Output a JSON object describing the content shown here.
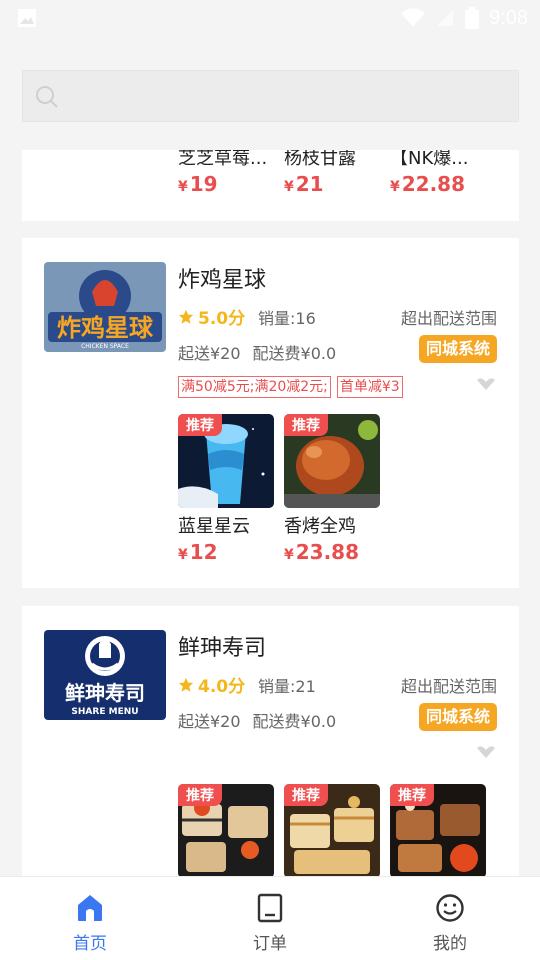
{
  "status_bar": {
    "time": "9:08",
    "icons": [
      "image-icon",
      "wifi-icon",
      "signal-icon",
      "battery-icon"
    ]
  },
  "search": {
    "placeholder": ""
  },
  "colors": {
    "price": "#e94e4e",
    "rating": "#f3b71c",
    "accent_tab": "#3b78f0",
    "city_tag": "#f5a623",
    "badge": "#ef4f4f"
  },
  "top_partial_card": {
    "items": [
      {
        "name": "芝芝草莓...",
        "currency": "¥",
        "price": "19"
      },
      {
        "name": "杨枝甘露",
        "currency": "¥",
        "price": "21"
      },
      {
        "name": "【NK爆...",
        "currency": "¥",
        "price": "22.88"
      }
    ]
  },
  "shops": [
    {
      "name": "炸鸡星球",
      "logo_text": "炸鸡星球",
      "logo_subtext": "CHICKEN SPACE",
      "score": "5.0分",
      "sales": "销量:16",
      "out_of_range": "超出配送范围",
      "min_order": "起送¥20",
      "delivery_fee": "配送费¥0.0",
      "city_tag": "同城系统",
      "promos": [
        "满50减5元;满20减2元;",
        "首单减¥3"
      ],
      "items": [
        {
          "badge": "推荐",
          "name": "蓝星星云",
          "currency": "¥",
          "price": "12"
        },
        {
          "badge": "推荐",
          "name": "香烤全鸡",
          "currency": "¥",
          "price": "23.88"
        }
      ]
    },
    {
      "name": "鲜珅寿司",
      "logo_text": "鲜珅寿司",
      "logo_subtext": "SHARE MENU",
      "score": "4.0分",
      "sales": "销量:21",
      "out_of_range": "超出配送范围",
      "min_order": "起送¥20",
      "delivery_fee": "配送费¥0.0",
      "city_tag": "同城系统",
      "items": [
        {
          "badge": "推荐"
        },
        {
          "badge": "推荐"
        },
        {
          "badge": "推荐"
        }
      ]
    }
  ],
  "tabbar": [
    {
      "label": "首页",
      "icon": "home-icon",
      "active": true
    },
    {
      "label": "订单",
      "icon": "order-icon",
      "active": false
    },
    {
      "label": "我的",
      "icon": "smile-icon",
      "active": false
    }
  ]
}
